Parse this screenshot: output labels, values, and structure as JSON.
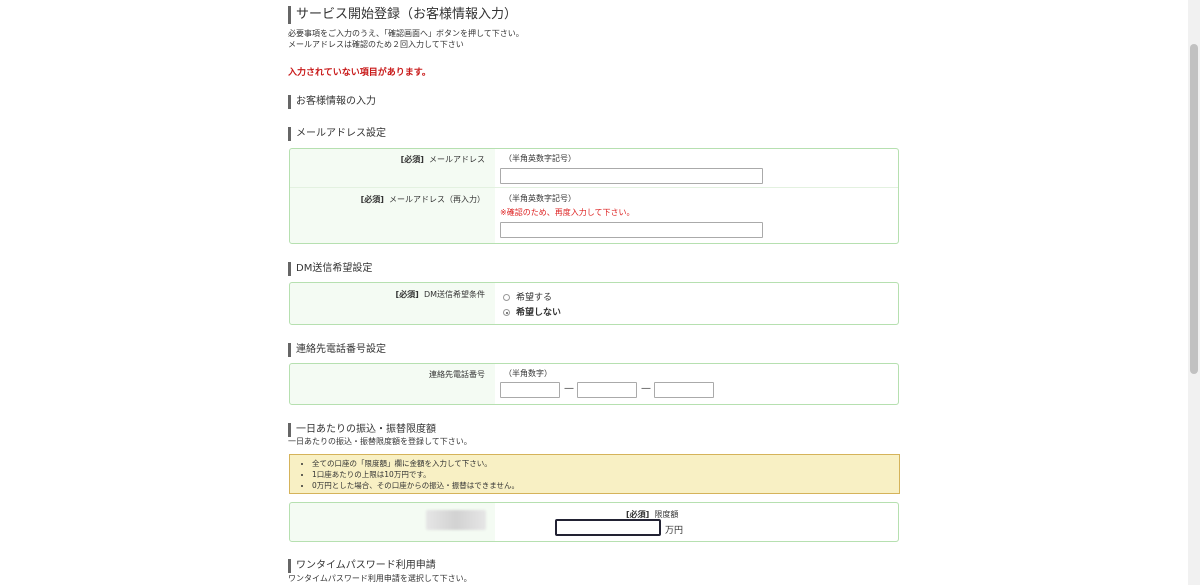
{
  "page": {
    "title": "サービス開始登録（お客様情報入力）",
    "desc1": "必要事項をご入力のうえ、「確認画面へ」ボタンを押して下さい。",
    "desc2": "メールアドレスは確認のため２回入力して下さい",
    "error": "入力されていない項目があります。",
    "section_main": "お客様情報の入力"
  },
  "email": {
    "heading": "メールアドレス設定",
    "required": "[必須]",
    "label1": "メールアドレス",
    "hint1": "（半角英数字記号）",
    "value1": "",
    "label2": "メールアドレス（再入力）",
    "hint2": "（半角英数字記号）",
    "note2": "※確認のため、再度入力して下さい。",
    "value2": ""
  },
  "dm": {
    "heading": "DM送信希望設定",
    "required": "[必須]",
    "label": "DM送信希望条件",
    "options": [
      "希望する",
      "希望しない"
    ],
    "selected": "希望しない"
  },
  "phone": {
    "heading": "連絡先電話番号設定",
    "label": "連絡先電話番号",
    "hint": "（半角数字）",
    "dash": "—",
    "part1": "",
    "part2": "",
    "part3": ""
  },
  "limit": {
    "heading": "一日あたりの振込・振替限度額",
    "desc": "一日あたりの振込・振替限度額を登録して下さい。",
    "notices": [
      "全ての口座の「限度額」欄に金額を入力して下さい。",
      "1口座あたりの上限は10万円です。",
      "0万円とした場合、その口座からの振込・振替はできません。"
    ],
    "required": "[必須]",
    "label": "限度額",
    "unit": "万円",
    "value": ""
  },
  "otp": {
    "heading": "ワンタイムパスワード利用申請",
    "desc": "ワンタイムパスワード利用申請を選択して下さい。"
  }
}
